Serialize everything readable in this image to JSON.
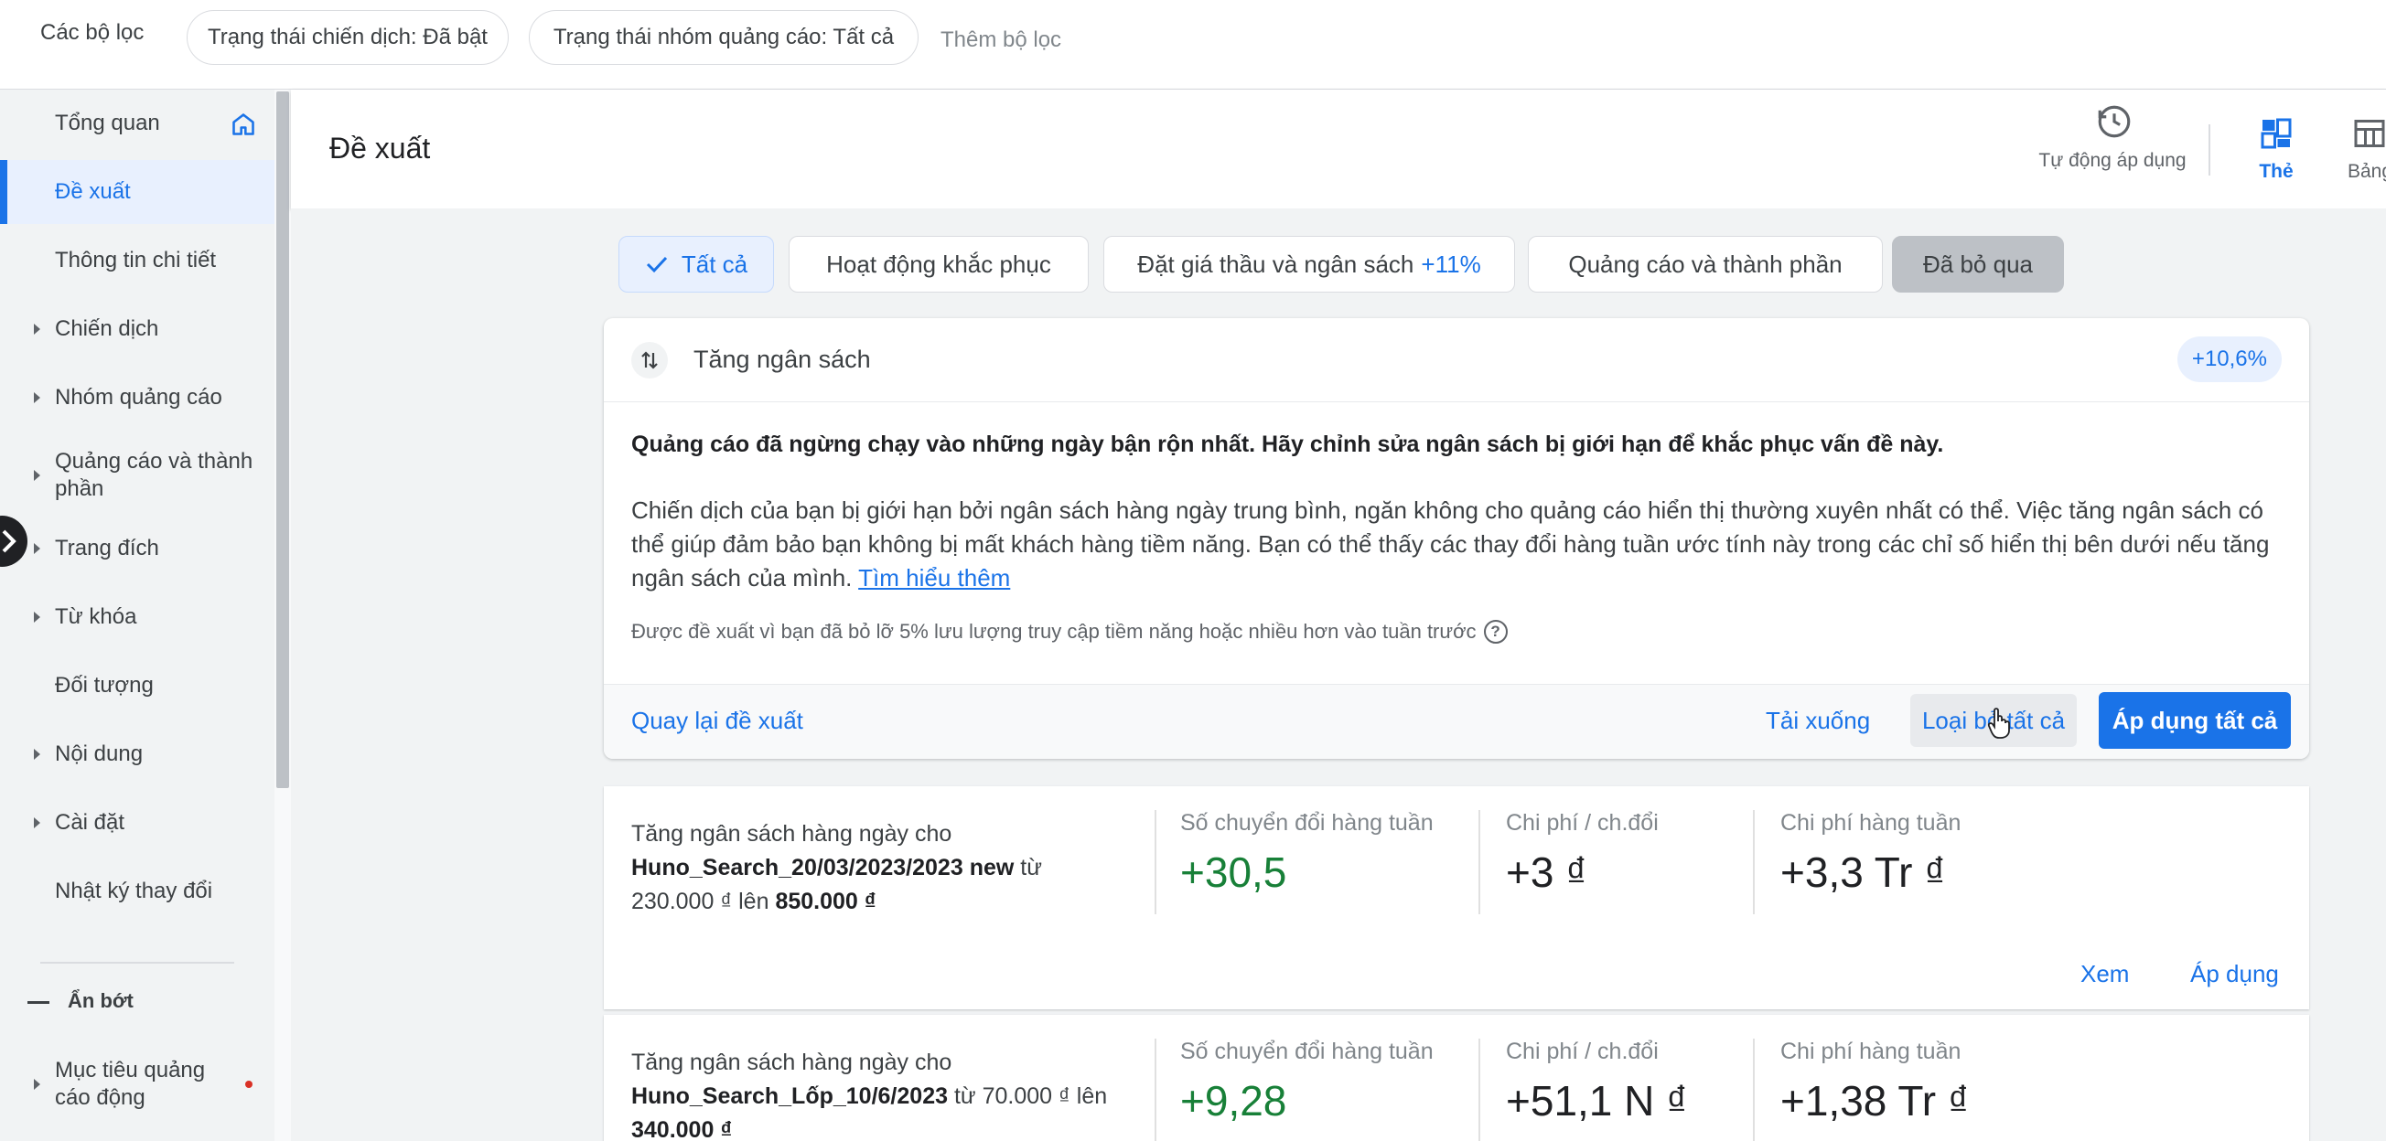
{
  "filters": {
    "label": "Các bộ lọc",
    "chips": [
      "Trạng thái chiến dịch: Đã bật",
      "Trạng thái nhóm quảng cáo: Tất cả"
    ],
    "add_filter": "Thêm bộ lọc"
  },
  "sidebar": {
    "items": [
      {
        "label": "Tổng quan"
      },
      {
        "label": "Đề xuất"
      },
      {
        "label": "Thông tin chi tiết"
      },
      {
        "label": "Chiến dịch"
      },
      {
        "label": "Nhóm quảng cáo"
      },
      {
        "label": "Quảng cáo và thành phần"
      },
      {
        "label": "Trang đích"
      },
      {
        "label": "Từ khóa"
      },
      {
        "label": "Đối tượng"
      },
      {
        "label": "Nội dung"
      },
      {
        "label": "Cài đặt"
      },
      {
        "label": "Nhật ký thay đổi"
      }
    ],
    "collapse_label": "Ẩn bớt",
    "extra_item": "Mục tiêu quảng cáo động"
  },
  "header": {
    "title": "Đề xuất",
    "auto_apply": "Tự động áp dụng",
    "view_card": "Thẻ",
    "view_table": "Bảng"
  },
  "tabs": [
    {
      "label": "Tất cả",
      "pct": ""
    },
    {
      "label": "Hoạt động khắc phục",
      "pct": ""
    },
    {
      "label": "Đặt giá thầu và ngân sách",
      "pct": "+11%"
    },
    {
      "label": "Quảng cáo và thành phần",
      "pct": ""
    },
    {
      "label": "Đã bỏ qua",
      "pct": ""
    }
  ],
  "card": {
    "title": "Tăng ngân sách",
    "uplift": "+10,6%",
    "headline": "Quảng cáo đã ngừng chạy vào những ngày bận rộn nhất. Hãy chỉnh sửa ngân sách bị giới hạn để khắc phục vấn đề này.",
    "body": "Chiến dịch của bạn bị giới hạn bởi ngân sách hàng ngày trung bình, ngăn không cho quảng cáo hiển thị thường xuyên nhất có thể. Việc tăng ngân sách có thể giúp đảm bảo bạn không bị mất khách hàng tiềm năng. Bạn có thể thấy các thay đổi hàng tuần ước tính này trong các chỉ số hiển thị bên dưới nếu tăng ngân sách của mình.",
    "learn_more": "Tìm hiểu thêm",
    "note": "Được đề xuất vì bạn đã bỏ lỡ 5% lưu lượng truy cập tiềm năng hoặc nhiều hơn vào tuần trước",
    "back": "Quay lại đề xuất",
    "download": "Tải xuống",
    "dismiss_all": "Loại bỏ tất cả",
    "apply_all": "Áp dụng tất cả"
  },
  "recs": [
    {
      "desc_prefix": "Tăng ngân sách hàng ngày cho",
      "campaign": "Huno_Search_20/03/2023/2023 new",
      "from_word": "từ",
      "from_value": "230.000 ₫",
      "to_word": "lên",
      "to_value": "850.000 ₫",
      "col1_label": "Số chuyển đổi hàng tuần",
      "col1_value": "+30,5",
      "col2_label": "Chi phí / ch.đổi",
      "col2_value": "+3 ₫",
      "col3_label": "Chi phí hàng tuần",
      "col3_value": "+3,3 Tr ₫",
      "view": "Xem",
      "apply": "Áp dụng"
    },
    {
      "desc_prefix": "Tăng ngân sách hàng ngày cho",
      "campaign": "Huno_Search_Lốp_10/6/2023",
      "from_word": "từ",
      "from_value": "70.000 ₫",
      "to_word": "lên",
      "to_value": "340.000 ₫",
      "col1_label": "Số chuyển đổi hàng tuần",
      "col1_value": "+9,28",
      "col2_label": "Chi phí / ch.đổi",
      "col2_value": "+51,1 N ₫",
      "col3_label": "Chi phí hàng tuần",
      "col3_value": "+1,38 Tr ₫"
    }
  ]
}
